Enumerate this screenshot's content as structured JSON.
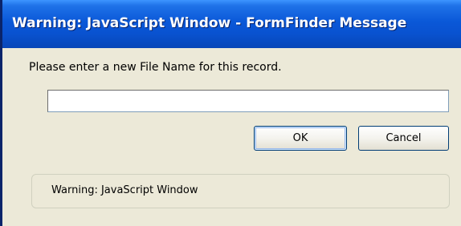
{
  "window": {
    "title": "Warning: JavaScript Window - FormFinder Message"
  },
  "dialog": {
    "prompt": "Please enter a new File Name for this record.",
    "input_value": "",
    "input_placeholder": "",
    "ok_label": "OK",
    "cancel_label": "Cancel",
    "status_text": "Warning: JavaScript Window"
  },
  "colors": {
    "titlebar": "#0a58d8",
    "window_background": "#ece9d8",
    "button_border": "#003c74"
  }
}
